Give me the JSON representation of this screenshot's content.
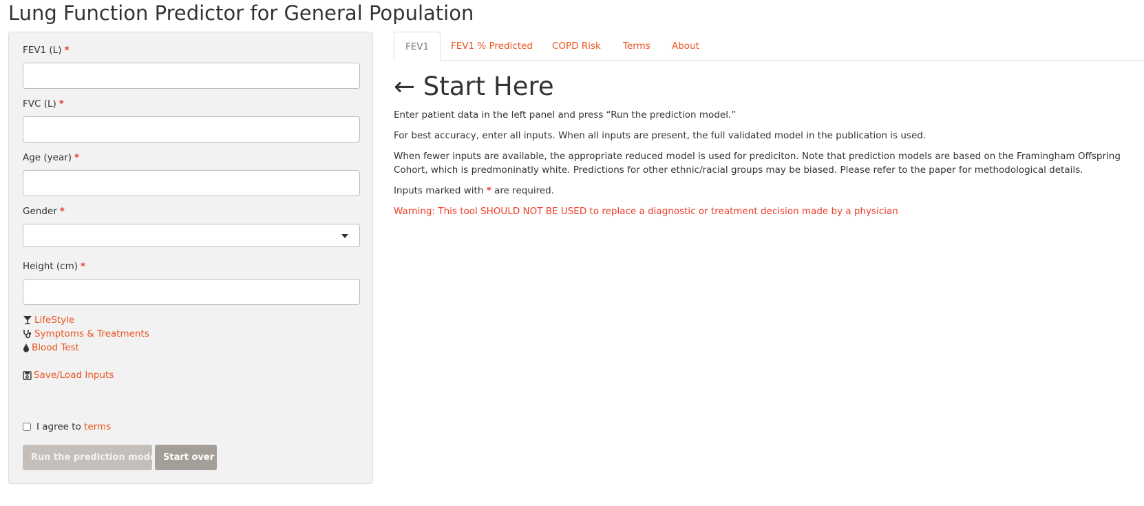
{
  "app_title": "Lung Function Predictor for General Population",
  "sidebar": {
    "fields": [
      {
        "label": "FEV1 (L)",
        "required_mark": "*",
        "value": ""
      },
      {
        "label": "FVC (L)",
        "required_mark": "*",
        "value": ""
      },
      {
        "label": "Age (year)",
        "required_mark": "*",
        "value": ""
      },
      {
        "label": "Gender",
        "required_mark": "*",
        "value": ""
      },
      {
        "label": "Height (cm)",
        "required_mark": "*",
        "value": ""
      }
    ],
    "links": [
      {
        "label": "LifeStyle",
        "icon": "glass-icon"
      },
      {
        "label": "Symptoms & Treatments",
        "icon": "stethoscope-icon"
      },
      {
        "label": "Blood Test",
        "icon": "drop-icon"
      }
    ],
    "save_load": {
      "label": "Save/Load Inputs",
      "icon": "floppy-disk-icon"
    },
    "agree": {
      "text": "I agree to",
      "link": "terms"
    },
    "buttons": {
      "run": "Run the prediction model",
      "start_over": "Start over"
    }
  },
  "tabs": [
    "FEV1",
    "FEV1 % Predicted",
    "COPD Risk",
    "Terms",
    "About"
  ],
  "main": {
    "heading": "← Start Here",
    "p1": "Enter patient data in the left panel and press “Run the prediction model.”",
    "p2": "For best accuracy, enter all inputs. When all inputs are present, the full validated model in the publication is used.",
    "p3": "When fewer inputs are available, the appropriate reduced model is used for prediciton. Note that prediction models are based on the Framingham Offspring Cohort, which is predmoninatly white. Predictions for other ethnic/racial groups may be biased. Please refer to the paper for methodological details.",
    "p4_before": "Inputs marked with",
    "p4_mark": "*",
    "p4_after": "are required.",
    "warning": "Warning: This tool SHOULD NOT BE USED to replace a diagnostic or treatment decision made by a physician"
  },
  "colors": {
    "link": "#e95420",
    "required": "#df382c",
    "warning": "#ef3b24",
    "sidebar_bg": "#f2f2f2"
  }
}
